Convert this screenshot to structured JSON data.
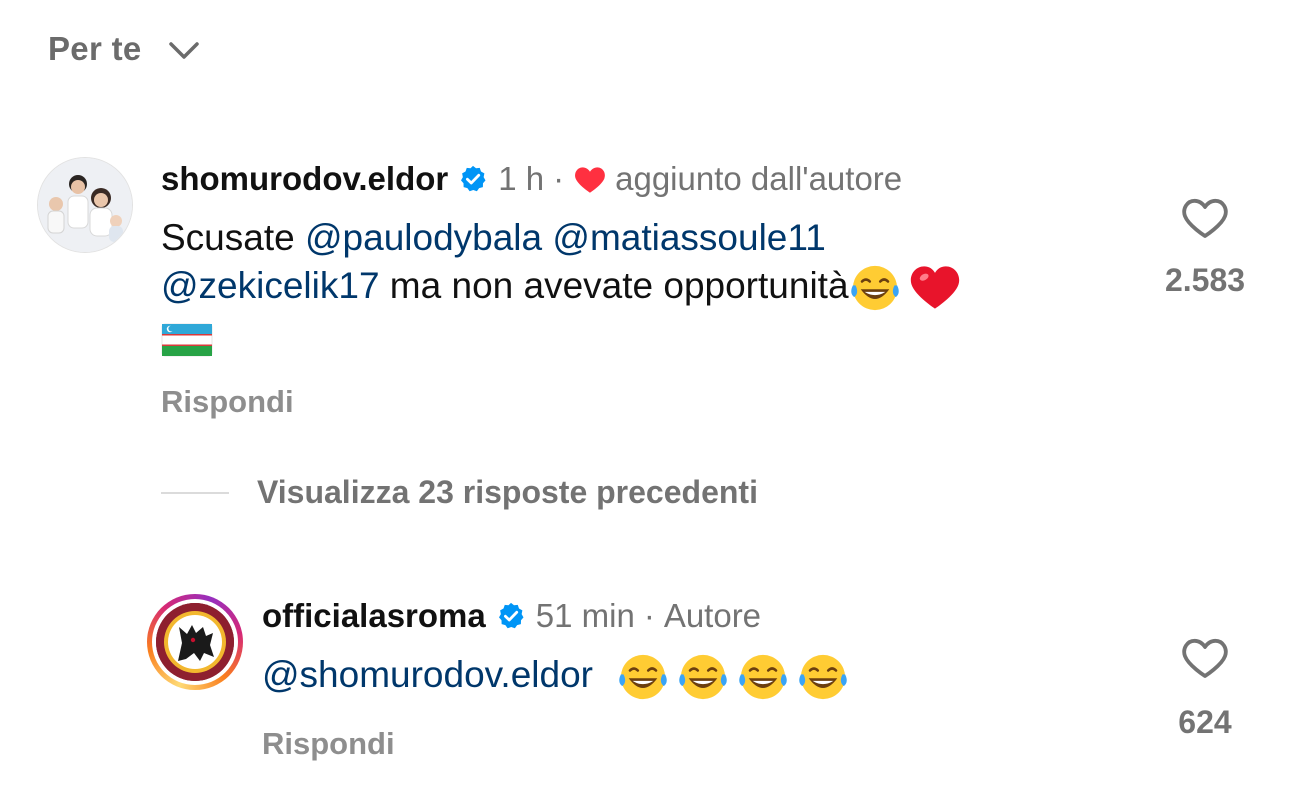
{
  "header": {
    "title": "Per te"
  },
  "comments": [
    {
      "username": "shomurodov.eldor",
      "time": "1 h",
      "separator": "·",
      "badge_text": "aggiunto dall'autore",
      "text": {
        "prefix": "Scusate ",
        "mention1": "@paulodybala",
        "mention2": "@matiassoule11",
        "mention3": "@zekicelik17",
        "body": " ma non avevate opportunità"
      },
      "reply_label": "Rispondi",
      "likes": "2.583"
    },
    {
      "username": "officialasroma",
      "time": "51 min",
      "separator": "·",
      "role": "Autore",
      "text": {
        "mention": "@shomurodov.eldor"
      },
      "reply_label": "Rispondi",
      "likes": "624"
    }
  ],
  "view_replies": {
    "label": "Visualizza 23 risposte precedenti"
  },
  "colors": {
    "mention": "#00376b",
    "verified": "#0095f6",
    "heart_red": "#ff3040",
    "muted": "#737373"
  }
}
